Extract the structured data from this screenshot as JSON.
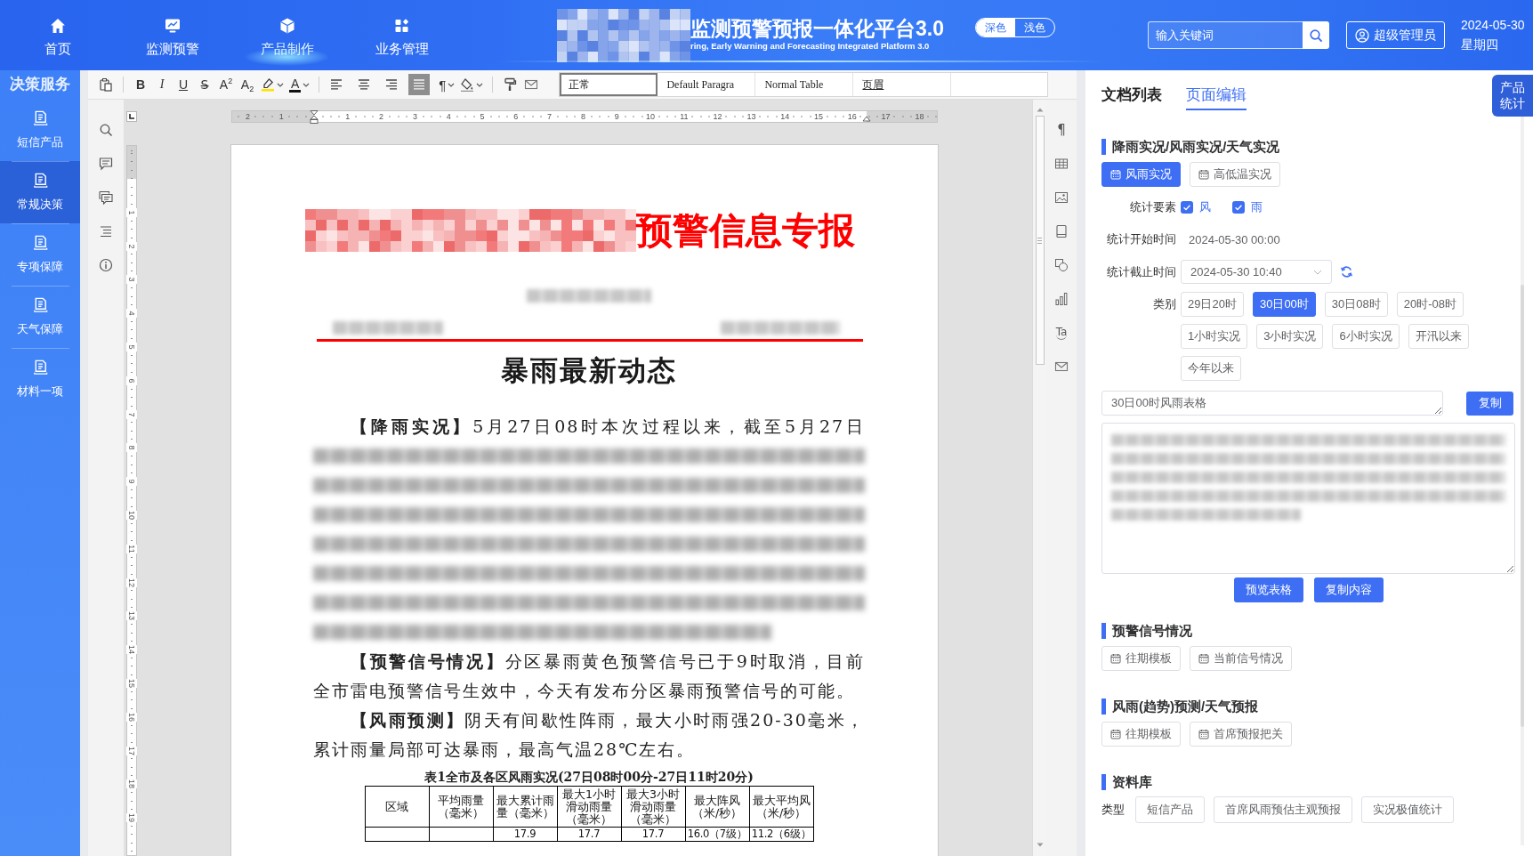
{
  "header": {
    "nav": [
      {
        "label": "首页",
        "selected": false
      },
      {
        "label": "监测预警",
        "selected": false
      },
      {
        "label": "产品制作",
        "selected": true
      },
      {
        "label": "业务管理",
        "selected": false
      }
    ],
    "title": "监测预警预报一体化平台3.0",
    "subtitle": "ring, Early Warning and Forecasting Integrated Platform 3.0",
    "theme": [
      {
        "label": "深色",
        "selected": true
      },
      {
        "label": "浅色",
        "selected": false
      }
    ],
    "search": {
      "placeholder": "输入关键词"
    },
    "user": "超级管理员",
    "date": "2024-05-30",
    "weekday": "星期四"
  },
  "sidebar": {
    "title": "决策服务",
    "items": [
      {
        "label": "短信产品",
        "selected": false
      },
      {
        "label": "常规决策",
        "selected": true
      },
      {
        "label": "专项保障",
        "selected": false
      },
      {
        "label": "天气保障",
        "selected": false
      },
      {
        "label": "材料一项",
        "selected": false
      }
    ]
  },
  "editor": {
    "toolbar": {
      "format": [
        "B",
        "I",
        "U",
        "S̶",
        "A$^{2}$",
        "A$_{2}$"
      ],
      "font_color": "A",
      "paragraph_mark": "¶",
      "alignment": [
        {
          "kind": "left",
          "selected": false
        },
        {
          "kind": "center",
          "selected": false
        },
        {
          "kind": "right",
          "selected": false
        },
        {
          "kind": "justify",
          "selected": true
        }
      ],
      "styles": [
        {
          "label": "正常",
          "selected": true
        },
        {
          "label": "Default Paragra",
          "selected": false
        },
        {
          "label": "Normal Table",
          "selected": false
        },
        {
          "label": "页眉",
          "selected": false
        }
      ]
    },
    "ruler": {
      "left_numbers": [
        "2",
        "1"
      ],
      "numbers": [
        "1",
        "2",
        "3",
        "4",
        "5",
        "6",
        "7",
        "8",
        "9",
        "10",
        "11",
        "12",
        "13",
        "14",
        "15",
        "16",
        "17",
        "18"
      ],
      "vertical_numbers": [
        "1",
        "2",
        "3",
        "4",
        "5",
        "6",
        "7",
        "8",
        "9",
        "10",
        "11",
        "12",
        "13",
        "14",
        "15",
        "16",
        "17",
        "18",
        "19"
      ]
    },
    "right_tools": {
      "paragraph_mark": "¶",
      "text_art": "Ta"
    },
    "document": {
      "title": "预警信息专报",
      "heading": "暴雨最新动态",
      "lead": "**【降雨实况】**5月27日08时本次过程以来，截至5月27日",
      "paragraphs": [
        "**【预警信号情况】**分区暴雨黄色预警信号已于9时取消，目前全市雷电预警信号生效中，今天有发布分区暴雨预警信号的可能。",
        "**【风雨预测】**阴天有间歇性阵雨，最大小时雨强20-30毫米，累计雨量局部可达暴雨，最高气温28℃左右。"
      ],
      "table": {
        "caption": "表1全市及各区风雨实况(27日08时00分-27日11时20分)",
        "columns": [
          "区域",
          "平均雨量（毫米）",
          "最大累计雨量（毫米）",
          "最大1小时滑动雨量（毫米）",
          "最大3小时滑动雨量（毫米）",
          "最大阵风（米/秒）",
          "最大平均风（米/秒）"
        ],
        "rows": [
          [
            null,
            null,
            "17.9",
            "17.7",
            "17.7",
            "16.0（7级）",
            "11.2（6级）"
          ]
        ]
      }
    }
  },
  "panel": {
    "tabs": [
      {
        "label": "文档列表",
        "selected": false
      },
      {
        "label": "页面编辑",
        "selected": true
      }
    ],
    "side_badge": "产品统计",
    "observation": {
      "title": "降雨实况/风雨实况/天气实况",
      "modes": [
        {
          "label": "风雨实况",
          "selected": true
        },
        {
          "label": "高低温实况",
          "selected": false
        }
      ],
      "elements": {
        "label": "统计要素",
        "options": [
          {
            "label": "风",
            "checked": true
          },
          {
            "label": "雨",
            "checked": true
          }
        ]
      },
      "start": {
        "label": "统计开始时间",
        "value": "2024-05-30 00:00"
      },
      "end": {
        "label": "统计截止时间",
        "value": "2024-05-30 10:40"
      },
      "category": {
        "label": "类别",
        "options": [
          {
            "label": "29日20时",
            "selected": false
          },
          {
            "label": "30日00时",
            "selected": true
          },
          {
            "label": "30日08时",
            "selected": false
          },
          {
            "label": "20时-08时",
            "selected": false
          },
          {
            "label": "1小时实况",
            "selected": false
          },
          {
            "label": "3小时实况",
            "selected": false
          },
          {
            "label": "6小时实况",
            "selected": false
          },
          {
            "label": "开汛以来",
            "selected": false
          },
          {
            "label": "今年以来",
            "selected": false
          }
        ]
      },
      "table_name": "30日00时风雨表格",
      "copy": "复制",
      "actions": [
        "预览表格",
        "复制内容"
      ]
    },
    "template_sections": [
      {
        "title": "预警信号情况",
        "buttons": [
          "往期模板",
          "当前信号情况"
        ]
      },
      {
        "title": "风雨(趋势)预测/天气预报",
        "buttons": [
          "往期模板",
          "首席预报把关"
        ]
      }
    ],
    "library": {
      "title": "资料库",
      "type_label": "类型",
      "buttons": [
        "短信产品",
        "首席风雨预估主观预报",
        "实况极值统计"
      ]
    }
  }
}
